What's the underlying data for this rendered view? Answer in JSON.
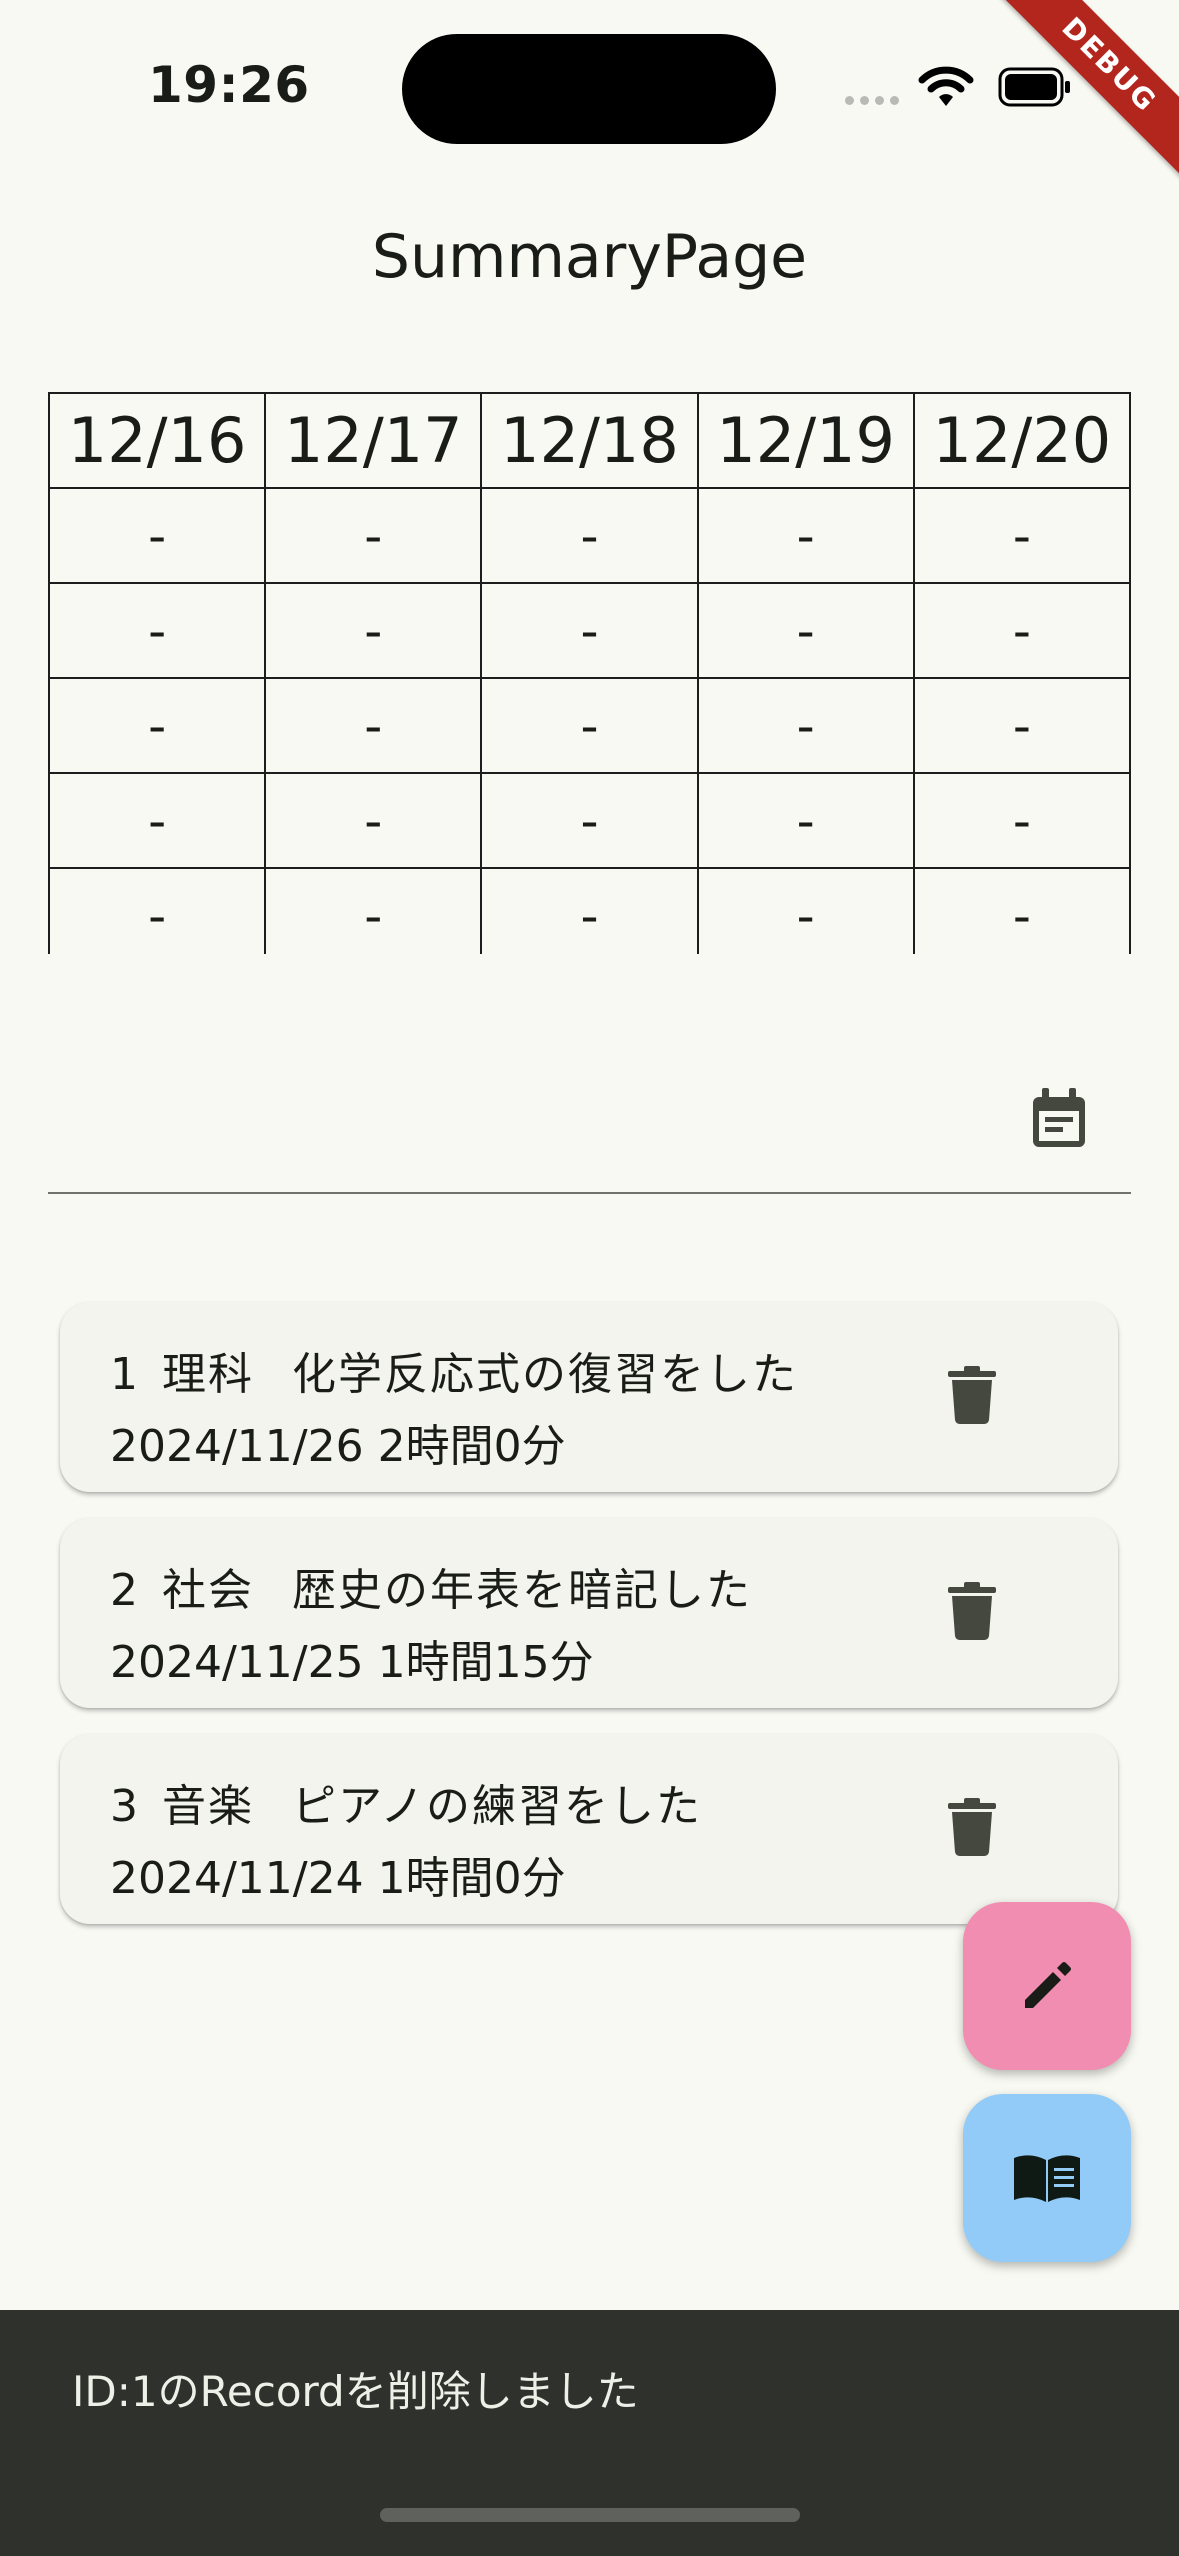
{
  "status_bar": {
    "time": "19:26",
    "debug_banner": "DEBUG"
  },
  "header": {
    "title": "SummaryPage"
  },
  "table": {
    "headers": [
      "12/16",
      "12/17",
      "12/18",
      "12/19",
      "12/20"
    ],
    "rows": [
      [
        "-",
        "-",
        "-",
        "-",
        "-"
      ],
      [
        "-",
        "-",
        "-",
        "-",
        "-"
      ],
      [
        "-",
        "-",
        "-",
        "-",
        "-"
      ],
      [
        "-",
        "-",
        "-",
        "-",
        "-"
      ],
      [
        "-",
        "-",
        "-",
        "-",
        "-"
      ]
    ]
  },
  "date_field": {
    "value": "",
    "icon": "calendar-icon"
  },
  "records": [
    {
      "id": "1",
      "subject": "理科",
      "content": "化学反応式の復習をした",
      "date": "2024/11/26",
      "duration": "2時間0分"
    },
    {
      "id": "2",
      "subject": "社会",
      "content": "歴史の年表を暗記した",
      "date": "2024/11/25",
      "duration": "1時間15分"
    },
    {
      "id": "3",
      "subject": "音楽",
      "content": "ピアノの練習をした",
      "date": "2024/11/24",
      "duration": "1時間0分"
    }
  ],
  "fabs": {
    "edit_icon": "pencil-icon",
    "book_icon": "book-icon"
  },
  "snackbar": {
    "message": "ID:1のRecordを削除しました"
  },
  "colors": {
    "background": "#F8F9F3",
    "fab_edit": "#F28DB2",
    "fab_book": "#92CBF8",
    "snackbar": "#2E312C"
  }
}
